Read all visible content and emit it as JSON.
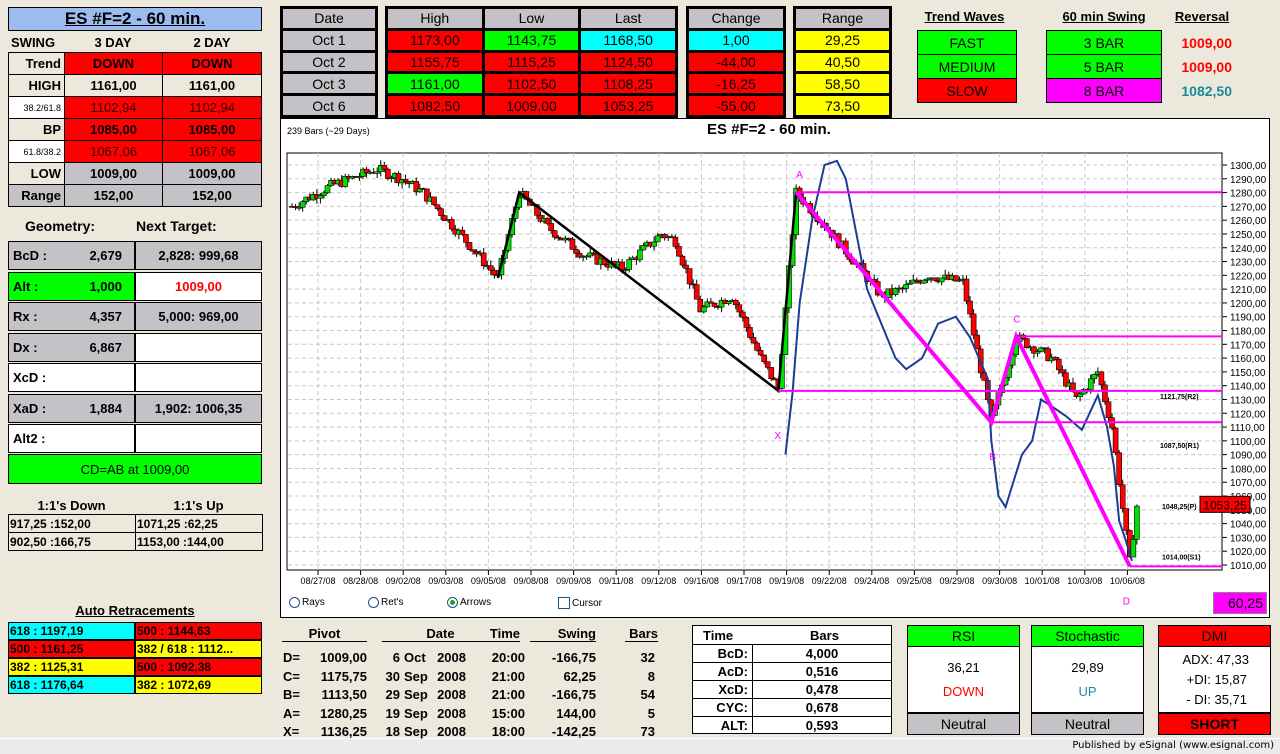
{
  "title": "ES #F=2 - 60 min.",
  "swing": {
    "label": "SWING",
    "col1": "3 DAY",
    "col2": "2 DAY",
    "rows": [
      {
        "label": "Trend",
        "v1": "DOWN",
        "v2": "DOWN"
      },
      {
        "label": "HIGH",
        "v1": "1161,00",
        "v2": "1161,00"
      },
      {
        "label": "38.2/61.8",
        "v1": "1102,94",
        "v2": "1102,94"
      },
      {
        "label": "BP",
        "v1": "1085,00",
        "v2": "1085,00"
      },
      {
        "label": "61.8/38.2",
        "v1": "1067,06",
        "v2": "1067,06"
      },
      {
        "label": "LOW",
        "v1": "1009,00",
        "v2": "1009,00"
      },
      {
        "label": "Range",
        "v1": "152,00",
        "v2": "152,00"
      }
    ]
  },
  "geometry": {
    "label": "Geometry:",
    "target_label": "Next Target:",
    "rows": [
      {
        "label": "BcD  :",
        "value": "2,679",
        "target": "2,828: 999,68"
      },
      {
        "label": "Alt    :",
        "value": "1,000",
        "target": "1009,00"
      },
      {
        "label": "Rx     :",
        "value": "4,357",
        "target": "5,000: 969,00"
      },
      {
        "label": "Dx     :",
        "value": "6,867",
        "target": ""
      },
      {
        "label": "XcD  :",
        "value": "",
        "target": ""
      },
      {
        "label": "XaD  :",
        "value": "1,884",
        "target": "1,902: 1006,35"
      },
      {
        "label": "Alt2  :",
        "value": "",
        "target": ""
      }
    ],
    "footer": "CD=AB at 1009,00"
  },
  "ones": {
    "down_label": "1:1's Down",
    "up_label": "1:1's Up",
    "down": [
      "917,25 :152,00",
      "902,50 :166,75"
    ],
    "up": [
      "1071,25 :62,25",
      "1153,00 :144,00"
    ]
  },
  "retracements": {
    "title": "Auto Retracements",
    "left": [
      "618 : 1197,19",
      "500 : 1161,25",
      "382 : 1125,31",
      "618 : 1176,64"
    ],
    "right": [
      "500 : 1144,63",
      "382 / 618 : 1112...",
      "500 : 1092,38",
      "382 : 1072,69"
    ]
  },
  "daily": {
    "headers": [
      "Date",
      "High",
      "Low",
      "Last",
      "Change",
      "Range"
    ],
    "rows": [
      {
        "date": "Oct  1",
        "high": "1173,00",
        "low": "1143,75",
        "last": "1168,50",
        "change": "1,00",
        "range": "29,25"
      },
      {
        "date": "Oct  2",
        "high": "1155,75",
        "low": "1115,25",
        "last": "1124,50",
        "change": "-44,00",
        "range": "40,50"
      },
      {
        "date": "Oct  3",
        "high": "1161,00",
        "low": "1102,50",
        "last": "1108,25",
        "change": "-16,25",
        "range": "58,50"
      },
      {
        "date": "Oct  6",
        "high": "1082,50",
        "low": "1009,00",
        "last": "1053,25",
        "change": "-55,00",
        "range": "73,50"
      }
    ]
  },
  "trend": {
    "title": "Trend Waves",
    "items": [
      "FAST",
      "MEDIUM",
      "SLOW"
    ]
  },
  "swing60": {
    "title": "60 min Swing",
    "items": [
      "3 BAR",
      "5 BAR",
      "8 BAR"
    ]
  },
  "reversal": {
    "title": "Reversal",
    "items": [
      "1009,00",
      "1009,00",
      "1082,50"
    ]
  },
  "chart": {
    "bars_label": "239 Bars (~29 Days)",
    "title": "ES #F=2 - 60 min.",
    "y_ticks": [
      "1300,00",
      "1290,00",
      "1280,00",
      "1270,00",
      "1260,00",
      "1250,00",
      "1240,00",
      "1230,00",
      "1220,00",
      "1210,00",
      "1200,00",
      "1190,00",
      "1180,00",
      "1170,00",
      "1160,00",
      "1150,00",
      "1140,00",
      "1130,00",
      "1120,00",
      "1110,00",
      "1100,00",
      "1090,00",
      "1080,00",
      "1070,00",
      "1060,00",
      "1050,00",
      "1040,00",
      "1030,00",
      "1020,00",
      "1010,00"
    ],
    "x_ticks": [
      "08/27/08",
      "08/28/08",
      "09/02/08",
      "09/03/08",
      "09/05/08",
      "09/08/08",
      "09/09/08",
      "09/11/08",
      "09/12/08",
      "09/16/08",
      "09/17/08",
      "09/19/08",
      "09/22/08",
      "09/24/08",
      "09/25/08",
      "09/29/08",
      "09/30/08",
      "10/01/08",
      "10/03/08",
      "10/06/08"
    ],
    "price_path": [
      [
        0,
        1270
      ],
      [
        11,
        1285
      ],
      [
        24,
        1297
      ],
      [
        31,
        1290
      ],
      [
        37,
        1280
      ],
      [
        49,
        1245
      ],
      [
        58,
        1218
      ],
      [
        64,
        1280
      ],
      [
        72,
        1255
      ],
      [
        82,
        1235
      ],
      [
        93,
        1225
      ],
      [
        104,
        1250
      ],
      [
        108,
        1245
      ],
      [
        115,
        1195
      ],
      [
        124,
        1205
      ],
      [
        132,
        1160
      ],
      [
        137,
        1138
      ],
      [
        142,
        1280
      ],
      [
        149,
        1260
      ],
      [
        160,
        1225
      ],
      [
        166,
        1205
      ],
      [
        172,
        1210
      ],
      [
        179,
        1220
      ],
      [
        189,
        1215
      ],
      [
        193,
        1165
      ],
      [
        197,
        1115
      ],
      [
        204,
        1175
      ],
      [
        214,
        1160
      ],
      [
        221,
        1130
      ],
      [
        227,
        1150
      ],
      [
        231,
        1110
      ],
      [
        236,
        1012
      ],
      [
        238,
        1053
      ]
    ],
    "oscillator": [
      [
        139,
        1090
      ],
      [
        141,
        1135
      ],
      [
        143,
        1200
      ],
      [
        146.5,
        1260
      ],
      [
        150,
        1300
      ],
      [
        153.5,
        1303
      ],
      [
        156,
        1290
      ],
      [
        159,
        1250
      ],
      [
        162,
        1210
      ],
      [
        166,
        1185
      ],
      [
        170,
        1160
      ],
      [
        173,
        1152
      ],
      [
        177.5,
        1160
      ],
      [
        182,
        1185
      ],
      [
        187,
        1190
      ],
      [
        191,
        1175
      ],
      [
        196,
        1145
      ],
      [
        197,
        1100
      ],
      [
        199,
        1060
      ],
      [
        201,
        1052
      ],
      [
        205.6,
        1090
      ],
      [
        208.5,
        1100
      ],
      [
        211,
        1130
      ],
      [
        214,
        1125
      ],
      [
        218,
        1118
      ],
      [
        222.5,
        1108
      ],
      [
        227,
        1133
      ],
      [
        229.6,
        1110
      ],
      [
        231.5,
        1082
      ],
      [
        233,
        1042
      ],
      [
        234.6,
        1030
      ],
      [
        236.6,
        1013
      ]
    ],
    "black_zigzag": [
      [
        58,
        1218
      ],
      [
        64,
        1280
      ],
      [
        137,
        1136.25
      ],
      [
        142,
        1280.25
      ]
    ],
    "pattern": [
      {
        "label": "X",
        "bar": 137,
        "price": 1136.25
      },
      {
        "label": "A",
        "bar": 142,
        "price": 1280.25
      },
      {
        "label": "B",
        "bar": 197,
        "price": 1113.5
      },
      {
        "label": "C",
        "bar": 204,
        "price": 1175.75
      },
      {
        "label": "D",
        "bar": 236,
        "price": 1009
      }
    ],
    "pivot_levels": [
      "1121,75(R2)",
      "1087,50(R1)",
      "1048,25(P)",
      "1014,00(S1)"
    ],
    "pivot_values": [
      1121.75,
      1087.5,
      1048.25,
      1014
    ],
    "last_price": "1053,25",
    "last_value": 1053.25,
    "options": [
      "Rays",
      "Ret's",
      "Arrows",
      "Cursor"
    ],
    "selected": "Arrows",
    "readout": "60,25",
    "colors": {
      "pattern": "#ff00ff",
      "oscillator": "#1a3c96",
      "up": "#00e000",
      "down": "#ff0000"
    }
  },
  "pivots": {
    "headers": [
      "Pivot",
      "Date",
      "Time",
      "Swing",
      "Bars"
    ],
    "rows": [
      {
        "p": "D=",
        "v": "1009,00",
        "d": "6",
        "m": "Oct",
        "y": "2008",
        "t": "20:00",
        "s": "-166,75",
        "b": "32"
      },
      {
        "p": "C=",
        "v": "1175,75",
        "d": "30",
        "m": "Sep",
        "y": "2008",
        "t": "21:00",
        "s": "62,25",
        "b": "8"
      },
      {
        "p": "B=",
        "v": "1113,50",
        "d": "29",
        "m": "Sep",
        "y": "2008",
        "t": "21:00",
        "s": "-166,75",
        "b": "54"
      },
      {
        "p": "A=",
        "v": "1280,25",
        "d": "19",
        "m": "Sep",
        "y": "2008",
        "t": "15:00",
        "s": "144,00",
        "b": "5"
      },
      {
        "p": "X=",
        "v": "1136,25",
        "d": "18",
        "m": "Sep",
        "y": "2008",
        "t": "18:00",
        "s": "-142,25",
        "b": "73"
      }
    ]
  },
  "timebars": {
    "h1": "Time",
    "h2": "Bars",
    "rows": [
      [
        "BcD:",
        "4,000"
      ],
      [
        "AcD:",
        "0,516"
      ],
      [
        "XcD:",
        "0,478"
      ],
      [
        "CYC:",
        "0,678"
      ],
      [
        "ALT:",
        "0,593"
      ]
    ]
  },
  "rsi": {
    "title": "RSI",
    "value": "36,21",
    "dir": "DOWN",
    "status": "Neutral"
  },
  "stoch": {
    "title": "Stochastic",
    "value": "29,89",
    "dir": "UP",
    "status": "Neutral"
  },
  "dmi": {
    "title": "DMI",
    "adx": "ADX:  47,33",
    "pdi": "+DI:  15,87",
    "mdi": "- DI:  35,71",
    "status": "SHORT"
  },
  "status_bar": "Published by eSignal (www.esignal.com)"
}
